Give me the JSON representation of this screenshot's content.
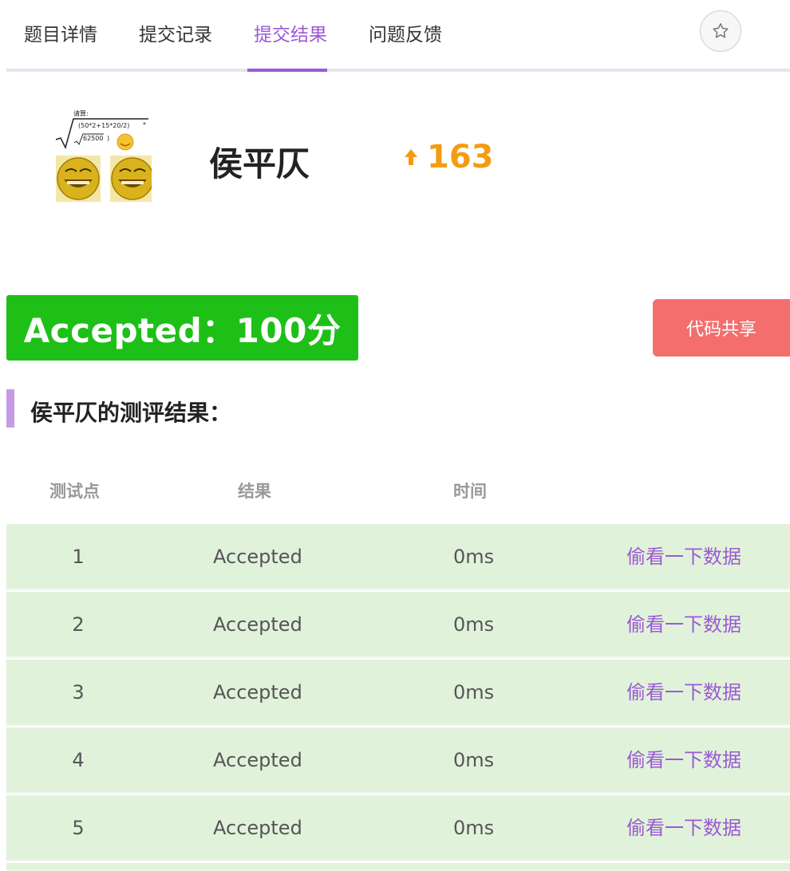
{
  "tabs": [
    {
      "label": "题目详情",
      "active": false
    },
    {
      "label": "提交记录",
      "active": false
    },
    {
      "label": "提交结果",
      "active": true
    },
    {
      "label": "问题反馈",
      "active": false
    }
  ],
  "star_icon": "star-outline-icon",
  "user": {
    "name": "侯平仄",
    "score_change": "163",
    "score_color": "#f39c12",
    "avatar_text": {
      "line1": "请算:",
      "line2": "(50*2+15*20/2)",
      "line3": "62500"
    }
  },
  "result": {
    "banner": "Accepted：100分",
    "banner_color": "#1ec018",
    "share_label": "代码共享",
    "share_color": "#f46e6e"
  },
  "section_title": "侯平仄的测评结果：",
  "table": {
    "headers": [
      "测试点",
      "结果",
      "时间"
    ],
    "rows": [
      {
        "idx": "1",
        "result": "Accepted",
        "time": "0ms",
        "link": "偷看一下数据"
      },
      {
        "idx": "2",
        "result": "Accepted",
        "time": "0ms",
        "link": "偷看一下数据"
      },
      {
        "idx": "3",
        "result": "Accepted",
        "time": "0ms",
        "link": "偷看一下数据"
      },
      {
        "idx": "4",
        "result": "Accepted",
        "time": "0ms",
        "link": "偷看一下数据"
      },
      {
        "idx": "5",
        "result": "Accepted",
        "time": "0ms",
        "link": "偷看一下数据"
      }
    ]
  },
  "accent_color": "#9b59d6"
}
